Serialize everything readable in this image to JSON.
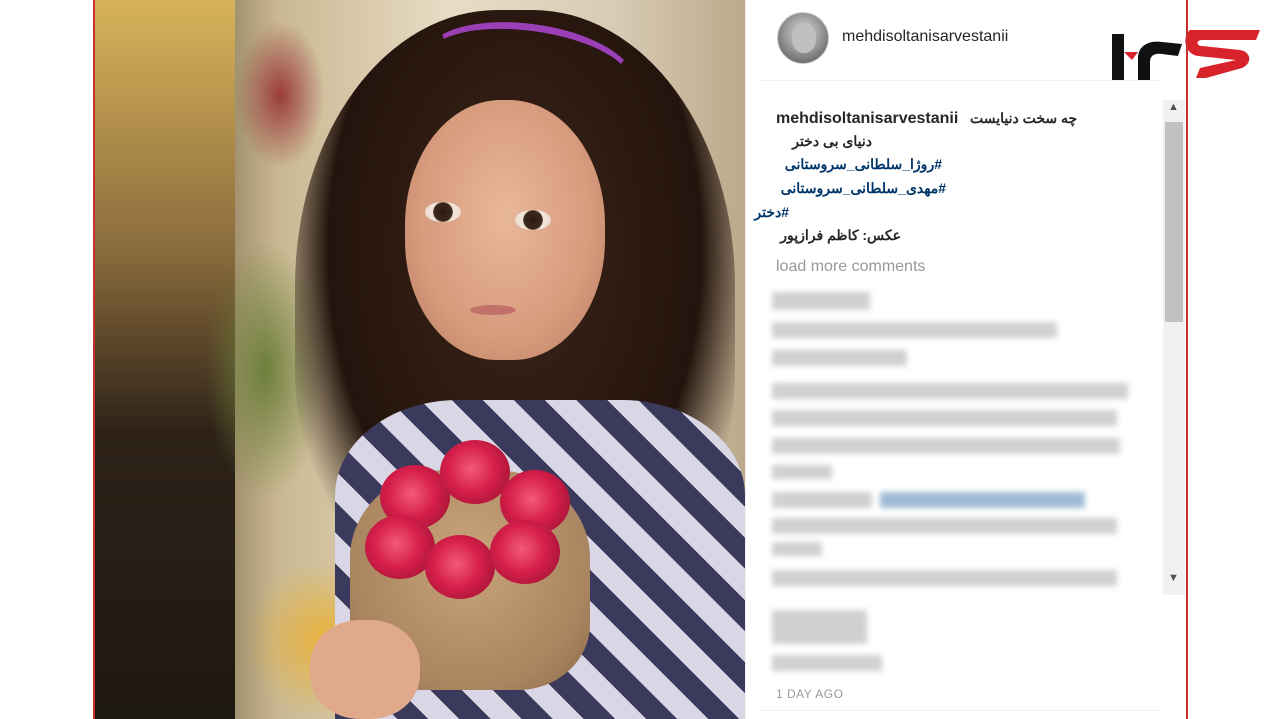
{
  "post": {
    "username": "mehdisoltanisarvestanii",
    "caption_user": "mehdisoltanisarvestanii",
    "caption_lines": [
      "چه سخت دنیایست",
      "دنیای بی دختر"
    ],
    "hashtags": [
      "#روژا_سلطانی_سروستانی",
      "#مهدی_سلطانی_سروستانی",
      "#دختر"
    ],
    "photo_credit": "عکس: کاظم فرازپور",
    "load_more": "load more comments",
    "timestamp": "1 DAY AGO"
  },
  "scrollbar": {
    "up_arrow": "▲",
    "down_arrow": "▼"
  },
  "icons": {
    "avatar": "profile-avatar",
    "logo": "rokna-logo"
  },
  "colors": {
    "frame_border": "#c9302c",
    "hashtag": "#003569",
    "muted": "#999999",
    "logo_black": "#111111",
    "logo_red": "#d8232a"
  }
}
